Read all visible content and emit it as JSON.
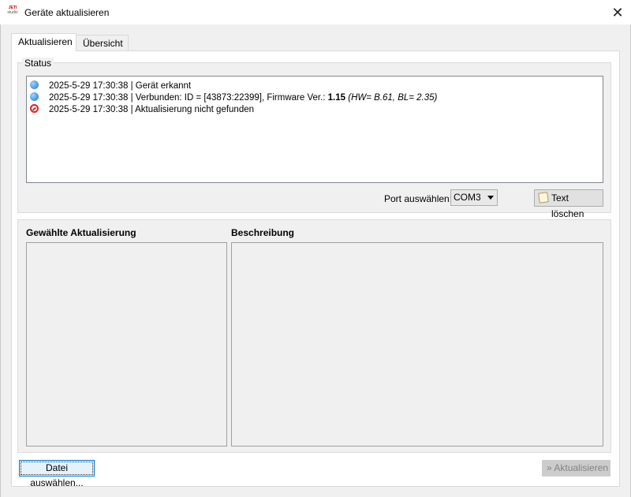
{
  "window": {
    "title": "Geräte aktualisieren",
    "logo_line1": "JETI",
    "logo_line2": "studio",
    "close_glyph": "✕"
  },
  "tabs": [
    {
      "label": "Aktualisieren",
      "active": true
    },
    {
      "label": "Übersicht",
      "active": false
    }
  ],
  "status": {
    "group_label": "Status",
    "log": [
      {
        "icon": "info-icon",
        "text": "2025-5-29 17:30:38  |  Gerät erkannt"
      },
      {
        "icon": "info-icon",
        "text": "2025-5-29 17:30:38  |  Verbunden: ID = [43873:22399], Firmware Ver.: ",
        "bold": "1.15",
        "italic": "(HW= B.61, BL= 2.35)"
      },
      {
        "icon": "error-icon",
        "text": "2025-5-29 17:30:38  |  Aktualisierung nicht gefunden"
      }
    ],
    "port_label": "Port auswählen:",
    "port_value": "COM3",
    "clear_button": "Text löschen"
  },
  "update": {
    "selected_header": "Gewählte Aktualisierung",
    "description_header": "Beschreibung"
  },
  "footer": {
    "select_file_button": "Datei auswählen...",
    "update_button": "Aktualisieren",
    "update_glyph": "»"
  },
  "colors": {
    "accent_focus": "#0078d7",
    "error": "#e02020",
    "info": "#1e73c8"
  }
}
